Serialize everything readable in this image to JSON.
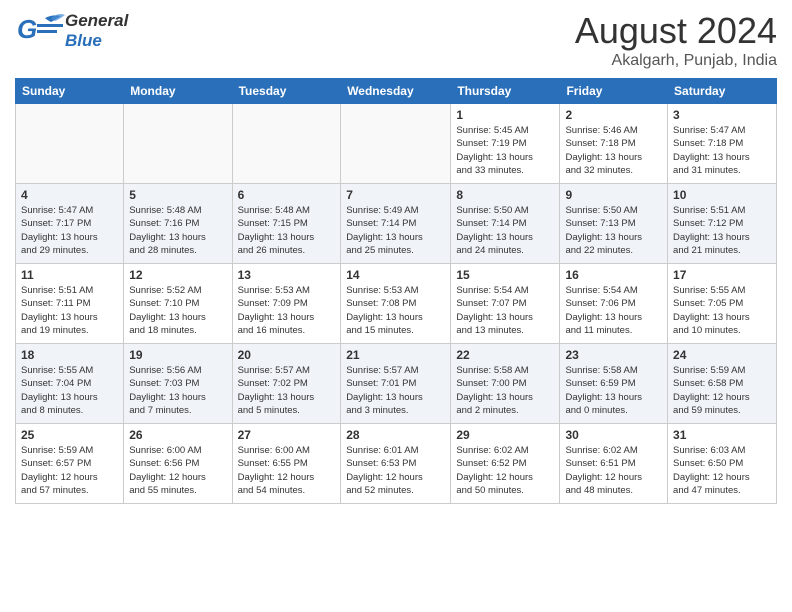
{
  "header": {
    "logo_general": "General",
    "logo_blue": "Blue",
    "month_year": "August 2024",
    "location": "Akalgarh, Punjab, India"
  },
  "weekdays": [
    "Sunday",
    "Monday",
    "Tuesday",
    "Wednesday",
    "Thursday",
    "Friday",
    "Saturday"
  ],
  "weeks": [
    [
      {
        "day": "",
        "info": ""
      },
      {
        "day": "",
        "info": ""
      },
      {
        "day": "",
        "info": ""
      },
      {
        "day": "",
        "info": ""
      },
      {
        "day": "1",
        "info": "Sunrise: 5:45 AM\nSunset: 7:19 PM\nDaylight: 13 hours\nand 33 minutes."
      },
      {
        "day": "2",
        "info": "Sunrise: 5:46 AM\nSunset: 7:18 PM\nDaylight: 13 hours\nand 32 minutes."
      },
      {
        "day": "3",
        "info": "Sunrise: 5:47 AM\nSunset: 7:18 PM\nDaylight: 13 hours\nand 31 minutes."
      }
    ],
    [
      {
        "day": "4",
        "info": "Sunrise: 5:47 AM\nSunset: 7:17 PM\nDaylight: 13 hours\nand 29 minutes."
      },
      {
        "day": "5",
        "info": "Sunrise: 5:48 AM\nSunset: 7:16 PM\nDaylight: 13 hours\nand 28 minutes."
      },
      {
        "day": "6",
        "info": "Sunrise: 5:48 AM\nSunset: 7:15 PM\nDaylight: 13 hours\nand 26 minutes."
      },
      {
        "day": "7",
        "info": "Sunrise: 5:49 AM\nSunset: 7:14 PM\nDaylight: 13 hours\nand 25 minutes."
      },
      {
        "day": "8",
        "info": "Sunrise: 5:50 AM\nSunset: 7:14 PM\nDaylight: 13 hours\nand 24 minutes."
      },
      {
        "day": "9",
        "info": "Sunrise: 5:50 AM\nSunset: 7:13 PM\nDaylight: 13 hours\nand 22 minutes."
      },
      {
        "day": "10",
        "info": "Sunrise: 5:51 AM\nSunset: 7:12 PM\nDaylight: 13 hours\nand 21 minutes."
      }
    ],
    [
      {
        "day": "11",
        "info": "Sunrise: 5:51 AM\nSunset: 7:11 PM\nDaylight: 13 hours\nand 19 minutes."
      },
      {
        "day": "12",
        "info": "Sunrise: 5:52 AM\nSunset: 7:10 PM\nDaylight: 13 hours\nand 18 minutes."
      },
      {
        "day": "13",
        "info": "Sunrise: 5:53 AM\nSunset: 7:09 PM\nDaylight: 13 hours\nand 16 minutes."
      },
      {
        "day": "14",
        "info": "Sunrise: 5:53 AM\nSunset: 7:08 PM\nDaylight: 13 hours\nand 15 minutes."
      },
      {
        "day": "15",
        "info": "Sunrise: 5:54 AM\nSunset: 7:07 PM\nDaylight: 13 hours\nand 13 minutes."
      },
      {
        "day": "16",
        "info": "Sunrise: 5:54 AM\nSunset: 7:06 PM\nDaylight: 13 hours\nand 11 minutes."
      },
      {
        "day": "17",
        "info": "Sunrise: 5:55 AM\nSunset: 7:05 PM\nDaylight: 13 hours\nand 10 minutes."
      }
    ],
    [
      {
        "day": "18",
        "info": "Sunrise: 5:55 AM\nSunset: 7:04 PM\nDaylight: 13 hours\nand 8 minutes."
      },
      {
        "day": "19",
        "info": "Sunrise: 5:56 AM\nSunset: 7:03 PM\nDaylight: 13 hours\nand 7 minutes."
      },
      {
        "day": "20",
        "info": "Sunrise: 5:57 AM\nSunset: 7:02 PM\nDaylight: 13 hours\nand 5 minutes."
      },
      {
        "day": "21",
        "info": "Sunrise: 5:57 AM\nSunset: 7:01 PM\nDaylight: 13 hours\nand 3 minutes."
      },
      {
        "day": "22",
        "info": "Sunrise: 5:58 AM\nSunset: 7:00 PM\nDaylight: 13 hours\nand 2 minutes."
      },
      {
        "day": "23",
        "info": "Sunrise: 5:58 AM\nSunset: 6:59 PM\nDaylight: 13 hours\nand 0 minutes."
      },
      {
        "day": "24",
        "info": "Sunrise: 5:59 AM\nSunset: 6:58 PM\nDaylight: 12 hours\nand 59 minutes."
      }
    ],
    [
      {
        "day": "25",
        "info": "Sunrise: 5:59 AM\nSunset: 6:57 PM\nDaylight: 12 hours\nand 57 minutes."
      },
      {
        "day": "26",
        "info": "Sunrise: 6:00 AM\nSunset: 6:56 PM\nDaylight: 12 hours\nand 55 minutes."
      },
      {
        "day": "27",
        "info": "Sunrise: 6:00 AM\nSunset: 6:55 PM\nDaylight: 12 hours\nand 54 minutes."
      },
      {
        "day": "28",
        "info": "Sunrise: 6:01 AM\nSunset: 6:53 PM\nDaylight: 12 hours\nand 52 minutes."
      },
      {
        "day": "29",
        "info": "Sunrise: 6:02 AM\nSunset: 6:52 PM\nDaylight: 12 hours\nand 50 minutes."
      },
      {
        "day": "30",
        "info": "Sunrise: 6:02 AM\nSunset: 6:51 PM\nDaylight: 12 hours\nand 48 minutes."
      },
      {
        "day": "31",
        "info": "Sunrise: 6:03 AM\nSunset: 6:50 PM\nDaylight: 12 hours\nand 47 minutes."
      }
    ]
  ]
}
